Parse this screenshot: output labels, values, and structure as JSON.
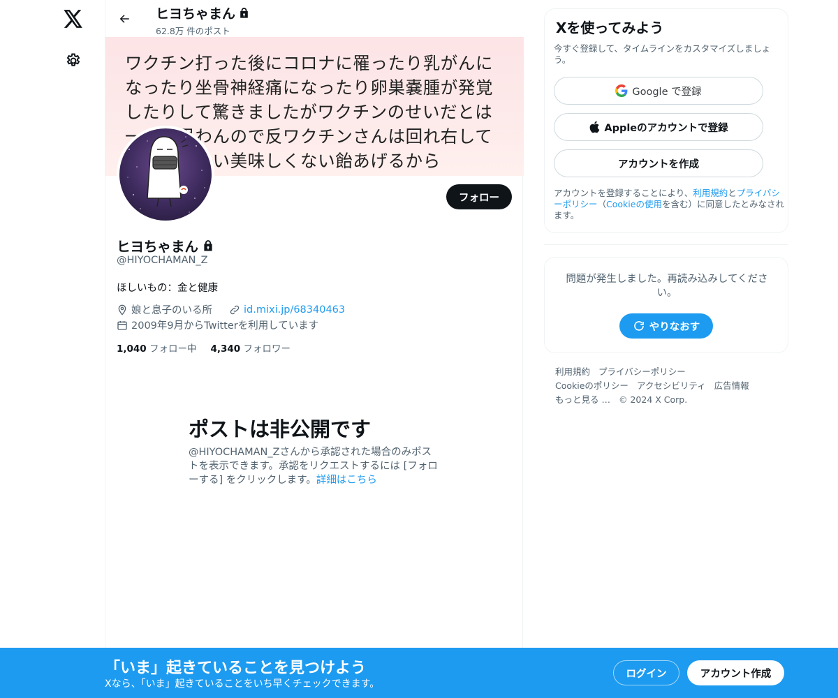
{
  "nav": {
    "logo_icon": "x-logo-icon",
    "settings_icon": "gear-icon"
  },
  "header": {
    "name": "ヒヨちゃまん",
    "post_count": "62.8万 件のポスト"
  },
  "banner": {
    "text": "ワクチン打った後にコロナに罹ったり乳がんに\nなったり坐骨神経痛になったり卵巣嚢腫が発覚\nしたりして驚きましたがワクチンのせいだとは\n一つも思わんので反ワクチンさんは回れ右して\nお帰り下さい美味しくない飴あげるから"
  },
  "profile": {
    "name": "ヒヨちゃまん",
    "handle": "@HIYOCHAMAN_Z",
    "bio": "ほしいもの：金と健康",
    "location": "娘と息子のいる所",
    "url": "id.mixi.jp/68340463",
    "joined": "2009年9月からTwitterを利用しています",
    "following_count": "1,040",
    "following_label": "フォロー中",
    "followers_count": "4,340",
    "followers_label": "フォロワー",
    "follow_button": "フォロー"
  },
  "private_notice": {
    "title": "ポストは非公開です",
    "body": "@HIYOCHAMAN_Zさんから承認された場合のみポストを表示できます。承認をリクエストするには [フォローする] をクリックします。",
    "link": "詳細はこちら"
  },
  "signup": {
    "title": "Xを使ってみよう",
    "subtitle": "今すぐ登録して、タイムラインをカスタマイズしましょう。",
    "google_label": "Google で登録",
    "apple_label": "Appleのアカウントで登録",
    "create_label": "アカウントを作成",
    "terms_prefix": "アカウントを登録することにより、",
    "terms_link": "利用規約",
    "terms_and": "と",
    "privacy_link": "プライバシーポリシー",
    "terms_paren_open": "（",
    "cookie_link": "Cookieの使用",
    "terms_suffix": "を含む）に同意したとみなされます。"
  },
  "error": {
    "message": "問題が発生しました。再読み込みしてください。",
    "retry_label": "やりなおす"
  },
  "footer": {
    "links": [
      "利用規約",
      "プライバシーポリシー",
      "Cookieのポリシー",
      "アクセシビリティ",
      "広告情報",
      "もっと見る …"
    ],
    "copyright": "© 2024 X Corp."
  },
  "bottom_bar": {
    "title": "「いま」起きていることを見つけよう",
    "subtitle": "Xなら、「いま」起きていることをいち早くチェックできます。",
    "login_label": "ログイン",
    "create_label": "アカウント作成"
  },
  "colors": {
    "accent": "#1d9bf0",
    "text": "#0f1419",
    "muted": "#536471"
  }
}
